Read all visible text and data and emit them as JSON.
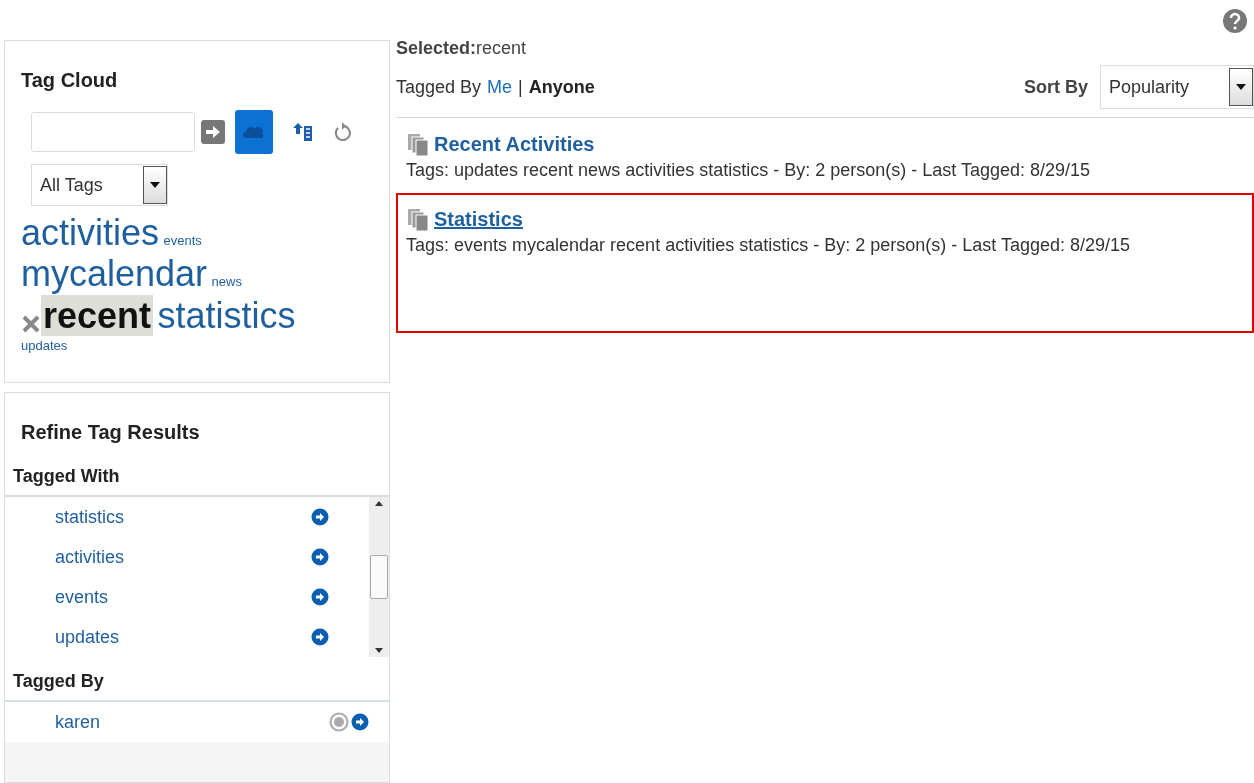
{
  "tag_cloud": {
    "title": "Tag Cloud",
    "filter": "All Tags",
    "tags": [
      {
        "label": "activities",
        "kind": "large",
        "selected": false
      },
      {
        "label": "events",
        "kind": "small",
        "selected": false
      },
      {
        "label": "mycalendar",
        "kind": "large",
        "selected": false
      },
      {
        "label": "news",
        "kind": "small",
        "selected": false
      },
      {
        "label": "recent",
        "kind": "large",
        "selected": true
      },
      {
        "label": "statistics",
        "kind": "large",
        "selected": false
      },
      {
        "label": "updates",
        "kind": "small",
        "selected": false
      }
    ]
  },
  "refine": {
    "title": "Refine Tag Results",
    "tagged_with": {
      "heading": "Tagged With",
      "items": [
        "statistics",
        "activities",
        "events",
        "updates"
      ]
    },
    "tagged_by": {
      "heading": "Tagged By",
      "items": [
        "karen"
      ]
    }
  },
  "main": {
    "selected_label": "Selected:",
    "selected_value": "recent",
    "tagged_by_label": "Tagged By",
    "tagged_by_options": [
      {
        "label": "Me",
        "selected": false
      },
      {
        "label": "Anyone",
        "selected": true
      }
    ],
    "separator": "|",
    "sort_label": "Sort By",
    "sort_value": "Popularity",
    "results": [
      {
        "title": "Recent Activities",
        "details": "Tags: updates recent news activities statistics - By: 2 person(s) - Last Tagged: 8/29/15",
        "highlighted": false
      },
      {
        "title": "Statistics",
        "details": "Tags: events mycalendar recent activities statistics - By: 2 person(s) - Last Tagged: 8/29/15",
        "highlighted": true
      }
    ]
  }
}
